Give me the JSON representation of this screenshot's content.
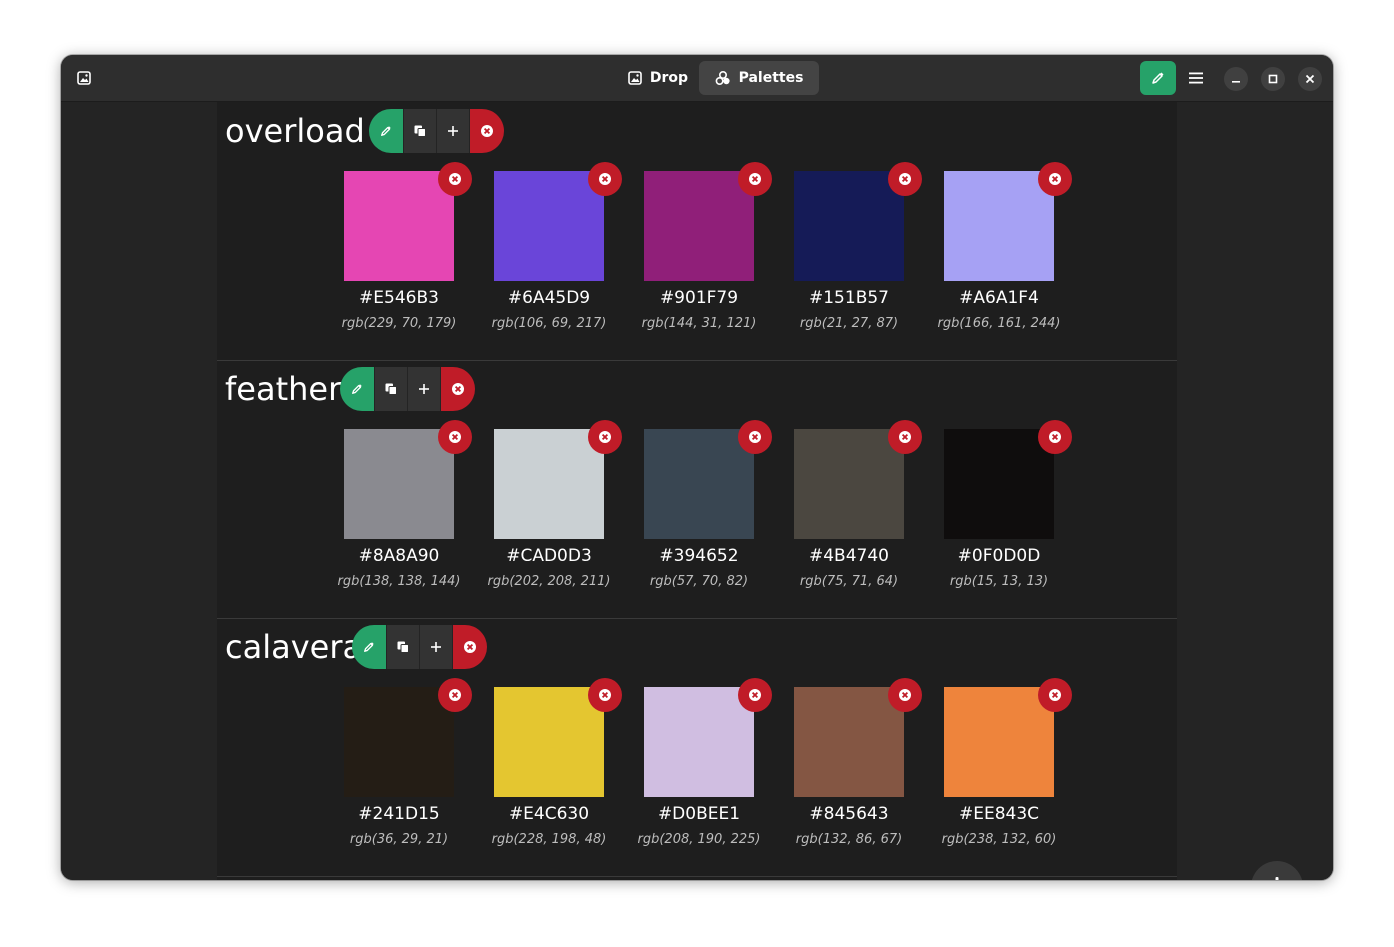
{
  "header": {
    "tabs": [
      {
        "label": "Drop",
        "icon": "image-icon",
        "active": false
      },
      {
        "label": "Palettes",
        "icon": "palette-icon",
        "active": true
      }
    ],
    "accent": "#26a269"
  },
  "palettes": [
    {
      "name": "overload",
      "colors": [
        {
          "hex": "#E546B3",
          "rgb": "rgb(229, 70, 179)"
        },
        {
          "hex": "#6A45D9",
          "rgb": "rgb(106, 69, 217)"
        },
        {
          "hex": "#901F79",
          "rgb": "rgb(144, 31, 121)"
        },
        {
          "hex": "#151B57",
          "rgb": "rgb(21, 27, 87)"
        },
        {
          "hex": "#A6A1F4",
          "rgb": "rgb(166, 161, 244)"
        }
      ]
    },
    {
      "name": "feather",
      "colors": [
        {
          "hex": "#8A8A90",
          "rgb": "rgb(138, 138, 144)"
        },
        {
          "hex": "#CAD0D3",
          "rgb": "rgb(202, 208, 211)"
        },
        {
          "hex": "#394652",
          "rgb": "rgb(57, 70, 82)"
        },
        {
          "hex": "#4B4740",
          "rgb": "rgb(75, 71, 64)"
        },
        {
          "hex": "#0F0D0D",
          "rgb": "rgb(15, 13, 13)"
        }
      ]
    },
    {
      "name": "calavera",
      "colors": [
        {
          "hex": "#241D15",
          "rgb": "rgb(36, 29, 21)"
        },
        {
          "hex": "#E4C630",
          "rgb": "rgb(228, 198, 48)"
        },
        {
          "hex": "#D0BEE1",
          "rgb": "rgb(208, 190, 225)"
        },
        {
          "hex": "#845643",
          "rgb": "rgb(132, 86, 67)"
        },
        {
          "hex": "#EE843C",
          "rgb": "rgb(238, 132, 60)"
        }
      ]
    }
  ]
}
